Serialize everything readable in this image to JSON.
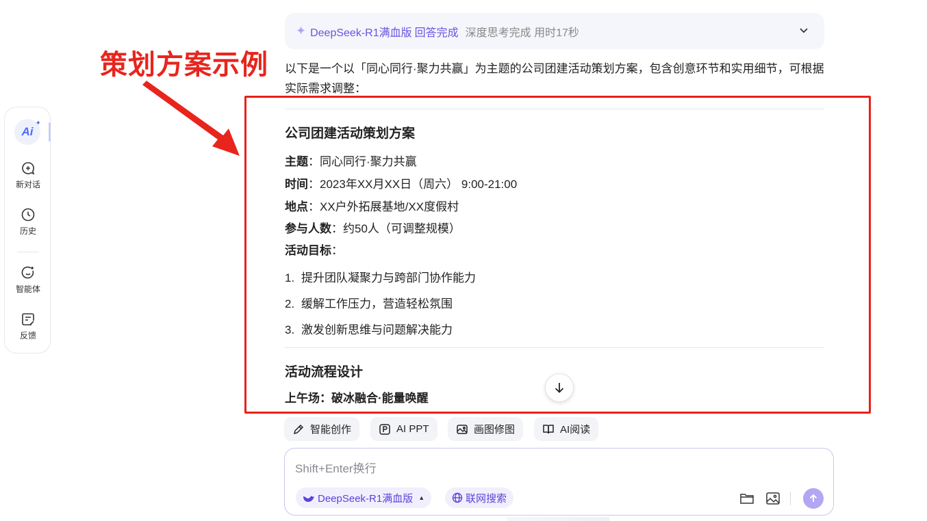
{
  "sidebar": {
    "logo": "Ai",
    "items": [
      {
        "label": "新对话",
        "icon": "new-chat-icon"
      },
      {
        "label": "历史",
        "icon": "clock-icon"
      },
      {
        "label": "智能体",
        "icon": "agent-icon"
      },
      {
        "label": "反馈",
        "icon": "feedback-icon"
      }
    ]
  },
  "annotation": {
    "title": "策划方案示例",
    "color": "#e8251d"
  },
  "status": {
    "model": "DeepSeek-R1满血版",
    "done": "回答完成",
    "thinking": "深度思考完成 用时17秒"
  },
  "answer": {
    "intro": "以下是一个以「同心同行·聚力共赢」为主题的公司团建活动策划方案，包含创意环节和实用细节，可根据实际需求调整：",
    "plan_title": "公司团建活动策划方案",
    "fields": [
      {
        "key": "主题",
        "value": "：同心同行·聚力共赢"
      },
      {
        "key": "时间",
        "value": "：2023年XX月XX日（周六） 9:00-21:00"
      },
      {
        "key": "地点",
        "value": "：XX户外拓展基地/XX度假村"
      },
      {
        "key": "参与人数",
        "value": "：约50人（可调整规模）"
      },
      {
        "key": "活动目标",
        "value": "："
      }
    ],
    "goals": [
      {
        "num": "1.",
        "text": "提升团队凝聚力与跨部门协作能力"
      },
      {
        "num": "2.",
        "text": "缓解工作压力，营造轻松氛围"
      },
      {
        "num": "3.",
        "text": "激发创新思维与问题解决能力"
      }
    ],
    "section_title": "活动流程设计",
    "morning_title": "上午场：破冰融合·能量唤醒"
  },
  "tools": [
    {
      "label": "智能创作",
      "icon": "pen-icon"
    },
    {
      "label": "AI PPT",
      "icon": "ppt-icon"
    },
    {
      "label": "画图修图",
      "icon": "image-edit-icon"
    },
    {
      "label": "AI阅读",
      "icon": "book-icon"
    }
  ],
  "input": {
    "placeholder": "Shift+Enter换行",
    "model_pill": "DeepSeek-R1满血版",
    "search_pill": "联网搜索"
  },
  "colors": {
    "accent": "#6a52e0",
    "highlight_box": "#e8201b"
  }
}
